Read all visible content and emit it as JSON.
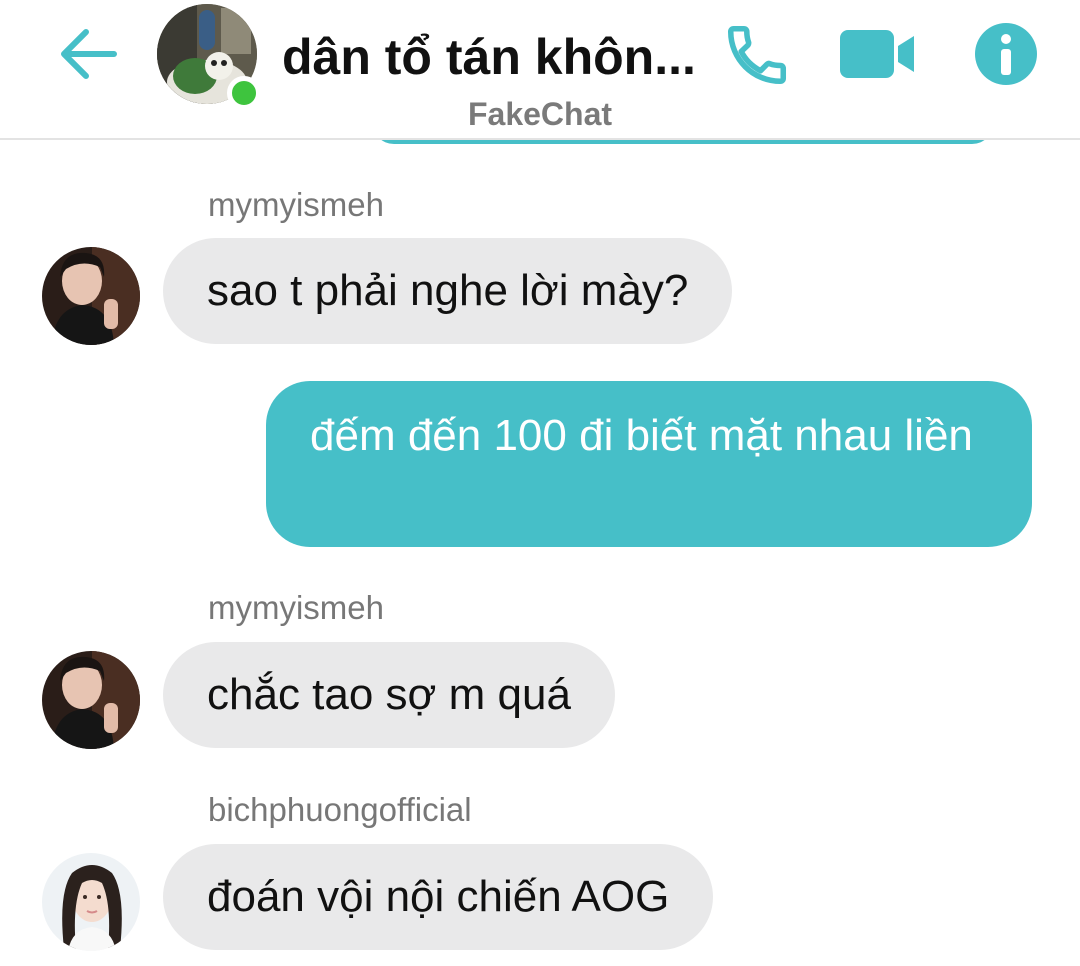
{
  "header": {
    "title": "dân tổ tán khôn...",
    "subtitle": "FakeChat",
    "back_icon": "arrow-left-icon",
    "call_icon": "phone-icon",
    "video_icon": "video-camera-icon",
    "info_icon": "info-icon",
    "accent_color": "#46bfc8",
    "online_color": "#3ec43e"
  },
  "messages": [
    {
      "direction": "incoming",
      "sender": "mymyismeh",
      "text": "sao t phải nghe lời mày?"
    },
    {
      "direction": "outgoing",
      "text": "đếm đến 100 đi biết mặt nhau liền"
    },
    {
      "direction": "incoming",
      "sender": "mymyismeh",
      "text": "chắc tao sợ m quá"
    },
    {
      "direction": "incoming",
      "sender": "bichphuongofficial",
      "text": "đoán vội nội chiến AOG"
    }
  ],
  "colors": {
    "incoming_bubble": "#e9e9ea",
    "outgoing_bubble": "#46bfc8",
    "sender_name": "#777777"
  }
}
